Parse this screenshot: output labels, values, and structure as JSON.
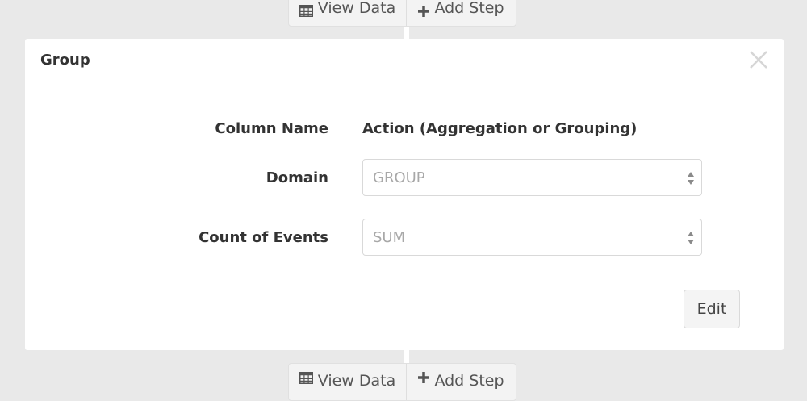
{
  "top_step_buttons": {
    "view_data_label": "View Data",
    "add_step_label": "Add Step",
    "view_data_icon": "table-icon",
    "add_step_icon": "plus-icon"
  },
  "card": {
    "title": "Group",
    "close_icon": "close-icon",
    "headers": {
      "column_name": "Column Name",
      "action": "Action (Aggregation or Grouping)"
    },
    "rows": [
      {
        "label": "Domain",
        "value": "GROUP"
      },
      {
        "label": "Count of Events",
        "value": "SUM"
      }
    ],
    "edit_label": "Edit"
  },
  "bottom_step_buttons": {
    "view_data_label": "View Data",
    "add_step_label": "Add Step",
    "view_data_icon": "table-icon",
    "add_step_icon": "plus-icon"
  }
}
